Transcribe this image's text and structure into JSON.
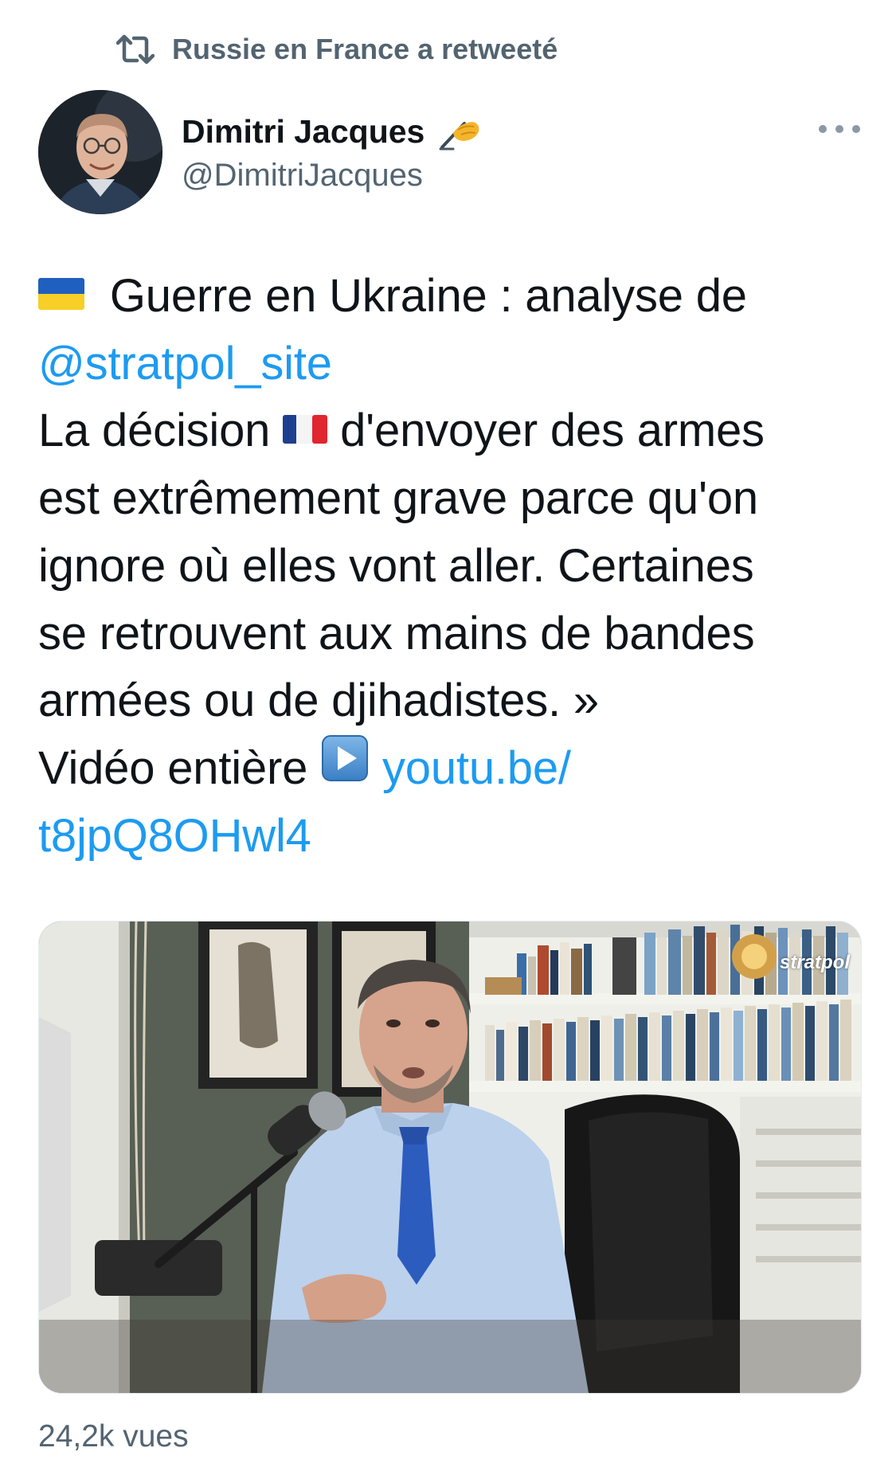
{
  "retweet": {
    "icon": "retweet-icon",
    "label": "Russie en France a retweeté"
  },
  "author": {
    "name": "Dimitri Jacques",
    "emoji": "writing-hand-icon",
    "handle": "@DimitriJacques"
  },
  "more_menu": {
    "icon": "more-horizontal-icon"
  },
  "tweet": {
    "line1_text": "Guerre en Ukraine : analyse de",
    "line1_flag": "ukraine-flag-icon",
    "mention": "@stratpol_site",
    "line3_a": "La décision",
    "line3_flag": "france-flag-icon",
    "line3_b": "d'envoyer des armes",
    "line4": "est extrêmement grave parce qu'on",
    "line5": "ignore où elles vont aller. Certaines",
    "line6": "se retrouvent aux mains de bandes",
    "line7": "armées ou de djihadistes. »",
    "line8_text": "Vidéo entière",
    "line8_emoji": "play-button-icon",
    "link_part1": "youtu.be/",
    "link_part2": "t8jpQ8OHwl4"
  },
  "video": {
    "watermark": "stratpol",
    "watermark_logo": "stratpol-logo-icon"
  },
  "views": "24,2k vues",
  "colors": {
    "link": "#1d9bf0",
    "secondary_text": "#536471",
    "primary_text": "#0f1419"
  }
}
